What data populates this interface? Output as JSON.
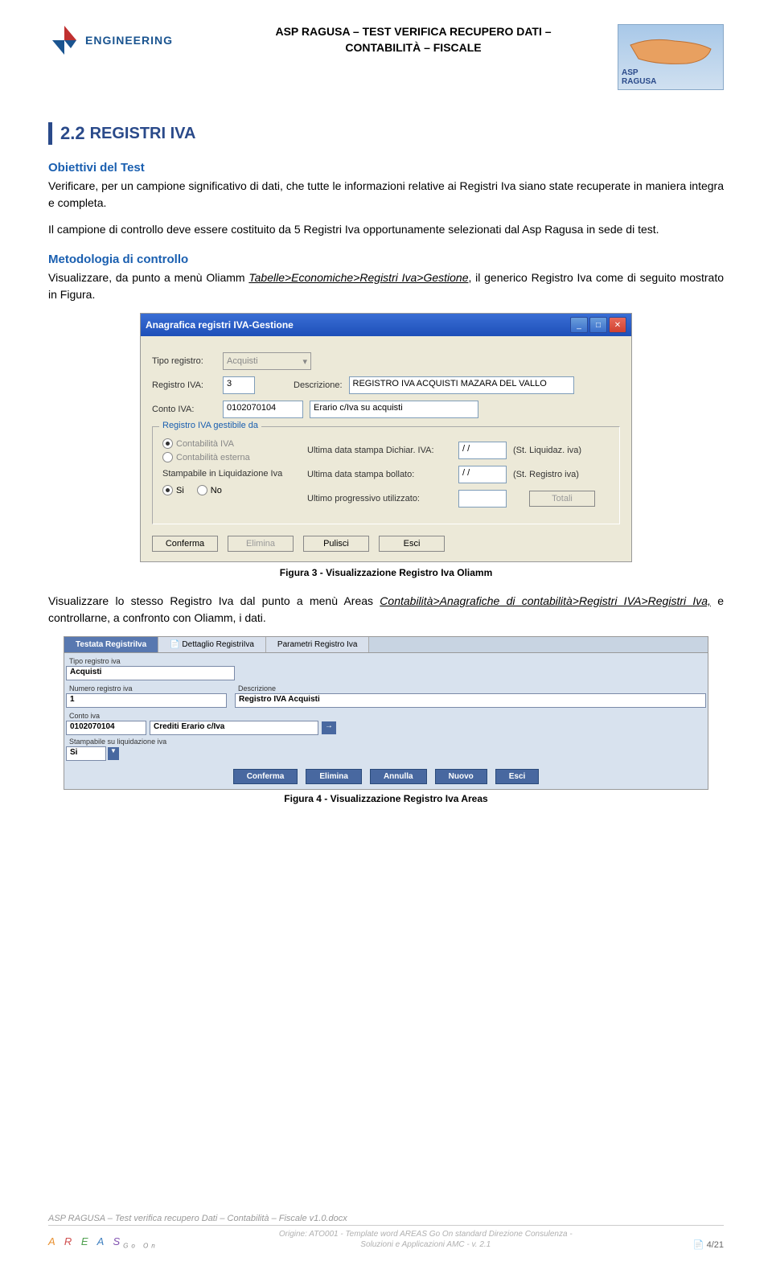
{
  "header": {
    "logo_text": "ENGINEERING",
    "title_line1": "ASP RAGUSA – TEST VERIFICA RECUPERO DATI –",
    "title_line2": "CONTABILITÀ – FISCALE",
    "badge_line1": "ASP",
    "badge_line2": "RAGUSA"
  },
  "section": {
    "number": "2.2",
    "title": "REGISTRI IVA"
  },
  "obiettivi": {
    "heading": "Obiettivi del Test",
    "p1": "Verificare, per un campione significativo di dati, che tutte le informazioni relative ai Registri Iva siano state recuperate in maniera integra e completa.",
    "p2": "Il campione di controllo deve essere costituito da 5 Registri Iva opportunamente selezionati dal Asp Ragusa in sede di test."
  },
  "metodologia": {
    "heading": "Metodologia di controllo",
    "p1_a": "Visualizzare, da punto a menù Oliamm ",
    "p1_u": "Tabelle>Economiche>Registri Iva>Gestione",
    "p1_b": ", il generico Registro Iva come di seguito mostrato in Figura."
  },
  "win1": {
    "title": "Anagrafica registri IVA-Gestione",
    "tipo_label": "Tipo registro:",
    "tipo_value": "Acquisti",
    "regiva_label": "Registro IVA:",
    "regiva_value": "3",
    "descr_label": "Descrizione:",
    "descr_value": "REGISTRO IVA ACQUISTI MAZARA DEL VALLO",
    "conto_label": "Conto IVA:",
    "conto_value": "0102070104",
    "conto_desc": "Erario c/Iva su acquisti",
    "legend": "Registro IVA gestibile da",
    "radio1": "Contabilità IVA",
    "radio2": "Contabilità esterna",
    "stamp_label": "Stampabile in Liquidazione Iva",
    "si": "Si",
    "no": "No",
    "udich_label": "Ultima data stampa Dichiar. IVA:",
    "udich_val": "/ /",
    "udich_note": "(St. Liquidaz. iva)",
    "uboll_label": "Ultima data stampa bollato:",
    "uboll_val": "/ /",
    "uboll_note": "(St. Registro iva)",
    "uprog_label": "Ultimo progressivo utilizzato:",
    "btn_totali": "Totali",
    "btn_conferma": "Conferma",
    "btn_elimina": "Elimina",
    "btn_pulisci": "Pulisci",
    "btn_esci": "Esci"
  },
  "caption1": "Figura 3 - Visualizzazione Registro Iva Oliamm",
  "para2_a": "Visualizzare lo stesso Registro Iva dal punto a menù Areas ",
  "para2_u": "Contabilità>Anagrafiche di contabilità>Registri IVA>Registri Iva,",
  "para2_b": " e controllarne, a confronto con Oliamm, i dati.",
  "areas": {
    "tab1": "Testata RegistriIva",
    "tab2": "Dettaglio RegistriIva",
    "tab3": "Parametri Registro Iva",
    "tipo_label": "Tipo registro iva",
    "tipo_val": "Acquisti",
    "num_label": "Numero registro iva",
    "num_val": "1",
    "descr_label": "Descrizione",
    "descr_val": "Registro IVA Acquisti",
    "conto_label": "Conto iva",
    "conto_val": "0102070104",
    "conto_desc": "Crediti Erario c/Iva",
    "stamp_label": "Stampabile su liquidazione iva",
    "stamp_val": "Si",
    "btn_conferma": "Conferma",
    "btn_elimina": "Elimina",
    "btn_annulla": "Annulla",
    "btn_nuovo": "Nuovo",
    "btn_esci": "Esci"
  },
  "caption2": "Figura 4 - Visualizzazione Registro Iva Areas",
  "footer": {
    "top": "ASP RAGUSA – Test verifica recupero Dati – Contabilità – Fiscale v1.0.docx",
    "mid1": "Origine: ATO001 - Template word AREAS Go On standard Direzione Consulenza -",
    "mid2": "Soluzioni e Applicazioni AMC - v. 2.1",
    "page": "4/21"
  }
}
